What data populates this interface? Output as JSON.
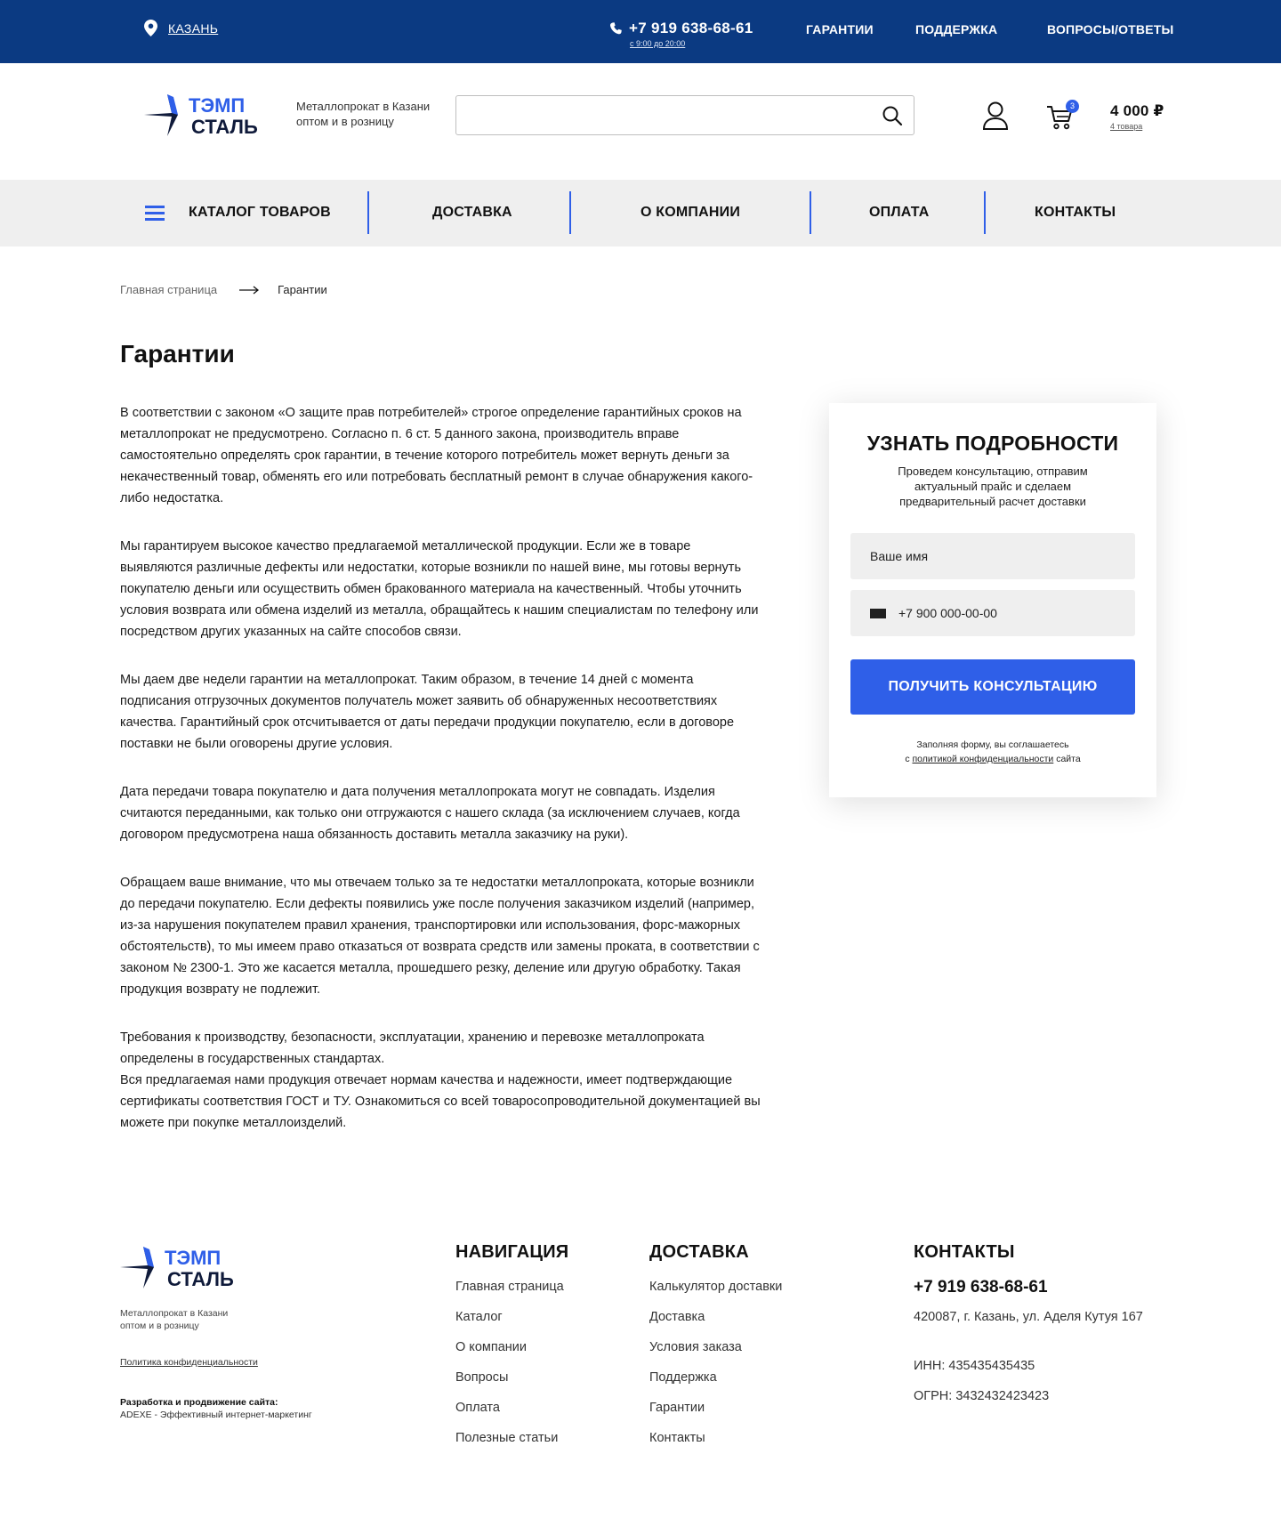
{
  "topbar": {
    "city": "КАЗАНЬ",
    "phone": "+7 919 638-68-61",
    "hours": "с 9:00 до 20:00",
    "links": [
      "ГАРАНТИИ",
      "ПОДДЕРЖКА",
      "ВОПРОСЫ/ОТВЕТЫ"
    ]
  },
  "brand": {
    "line1": "ТЭМП",
    "line2": "СТАЛЬ",
    "tagline_1": "Металлопрокат в Казани",
    "tagline_2": "оптом и в розницу"
  },
  "search": {
    "placeholder": ""
  },
  "cart": {
    "badge": "3",
    "sum": "4 000 ₽",
    "count": "4 товара"
  },
  "nav": {
    "catalog": "КАТАЛОГ ТОВАРОВ",
    "items": [
      "ДОСТАВКА",
      "О КОМПАНИИ",
      "ОПЛАТА",
      "КОНТАКТЫ"
    ]
  },
  "breadcrumb": {
    "home": "Главная страница",
    "current": "Гарантии"
  },
  "page": {
    "title": "Гарантии",
    "paragraphs": [
      "В соответствии с законом «О защите прав потребителей» строгое определение гарантийных сроков на металлопрокат не предусмотрено. Согласно п. 6 ст. 5 данного закона, производитель вправе самостоятельно определять срок гарантии, в течение которого потребитель может вернуть деньги за некачественный товар, обменять его или потребовать бесплатный ремонт в случае обнаружения какого-либо недостатка.",
      "Мы гарантируем высокое качество предлагаемой металлической продукции. Если же в товаре выявляются различные дефекты или недостатки, которые возникли по нашей вине, мы готовы вернуть покупателю деньги или осуществить обмен бракованного материала на качественный. Чтобы уточнить условия возврата или обмена изделий из металла, обращайтесь к нашим специалистам по телефону или посредством других указанных на сайте способов связи.",
      "Мы даем две недели гарантии на металлопрокат. Таким образом, в течение 14 дней с момента подписания отгрузочных документов получатель может заявить об обнаруженных несоответствиях качества. Гарантийный срок отсчитывается от даты передачи продукции покупателю, если в договоре поставки не были оговорены другие условия.",
      "Дата передачи товара покупателю и дата получения металлопроката могут не совпадать. Изделия считаются переданными, как только они отгружаются с нашего склада (за исключением случаев, когда договором предусмотрена наша обязанность доставить металла заказчику на руки).",
      "Обращаем ваше внимание, что мы отвечаем только за те недостатки металлопроката, которые возникли до передачи покупателю. Если дефекты появились уже после получения заказчиком изделий (например, из-за нарушения покупателем правил хранения, транспортировки или использования, форс-мажорных обстоятельств), то мы имеем право отказаться от возврата средств или замены проката, в соответствии с законом № 2300-1. Это же касается металла, прошедшего резку, деление или другую обработку. Такая продукция возврату не подлежит.",
      "Требования к производству, безопасности, эксплуатации, хранению и перевозке металлопроката определены в государственных стандартах.",
      "Вся предлагаемая нами продукция отвечает нормам качества и надежности, имеет подтверждающие сертификаты соответствия ГОСТ и ТУ. Ознакомиться со всей товаросопроводительной документацией вы можете при покупке металлоизделий."
    ]
  },
  "form": {
    "title": "УЗНАТЬ ПОДРОБНОСТИ",
    "subtitle": "Проведем консультацию, отправим актуальный прайс и сделаем предварительный расчет доставки",
    "name_placeholder": "Ваше имя",
    "phone_placeholder": "+7 900 000-00-00",
    "submit": "ПОЛУЧИТЬ КОНСУЛЬТАЦИЮ",
    "agree_1": "Заполняя форму, вы соглашаетесь",
    "agree_2": "с ",
    "agree_link": "политикой конфиденциальности",
    "agree_3": " сайта"
  },
  "footer": {
    "privacy": "Политика конфиденциальности",
    "dev_title": "Разработка и продвижение сайта:",
    "dev_value": "ADEXE - Эффективный интернет-маркетинг",
    "nav_title": "НАВИГАЦИЯ",
    "nav_items": [
      "Главная страница",
      "Каталог",
      "О компании",
      "Вопросы",
      "Оплата",
      "Полезные статьи"
    ],
    "delivery_title": "ДОСТАВКА",
    "delivery_items": [
      "Калькулятор доставки",
      "Доставка",
      "Условия заказа",
      "Поддержка",
      "Гарантии",
      "Контакты"
    ],
    "contacts_title": "КОНТАКТЫ",
    "phone": "+7 919 638-68-61",
    "address": "420087,  г. Казань, ул. Аделя Кутуя 167",
    "inn": "ИНН: 435435435435",
    "ogrn": "ОГРН: 3432432423423"
  },
  "colors": {
    "topbar": "#0b3a82",
    "accent": "#2f5fe8",
    "nav_bg": "#efefef",
    "field_bg": "#efefef"
  },
  "icons": [
    "location-pin-icon",
    "phone-icon",
    "search-icon",
    "user-icon",
    "cart-icon",
    "burger-menu-icon",
    "arrow-right-icon",
    "flag-icon"
  ]
}
